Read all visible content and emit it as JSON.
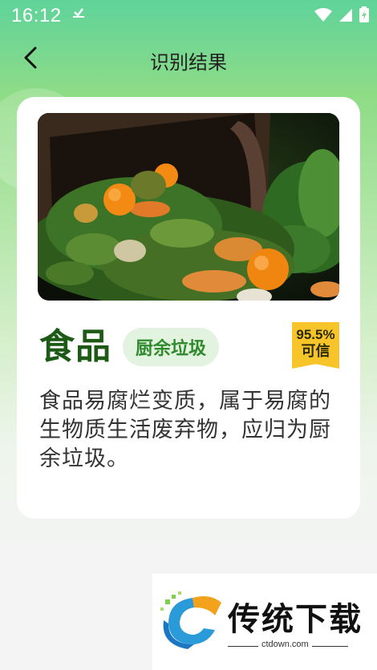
{
  "status_bar": {
    "time": "16:12",
    "extra_icon": "download-done-icon",
    "icons": [
      "wifi-icon",
      "signal-icon",
      "battery-icon"
    ]
  },
  "header": {
    "title": "识别结果",
    "back_icon": "chevron-left-icon"
  },
  "result": {
    "image_alt": "food-waste-photo",
    "item_name": "食品",
    "category": "厨余垃圾",
    "confidence_percent": "95.5%",
    "confidence_label": "可信",
    "description": "食品易腐烂变质，属于易腐的生物质生活废弃物，应归为厨余垃圾。"
  },
  "watermark": {
    "title": "传统下载",
    "subtitle": "ctdown.com"
  },
  "colors": {
    "accent_green": "#2f8a2c",
    "title_green": "#1c5a16",
    "badge_bg": "#e2f3e0",
    "confidence_bg": "#f7c52a"
  }
}
